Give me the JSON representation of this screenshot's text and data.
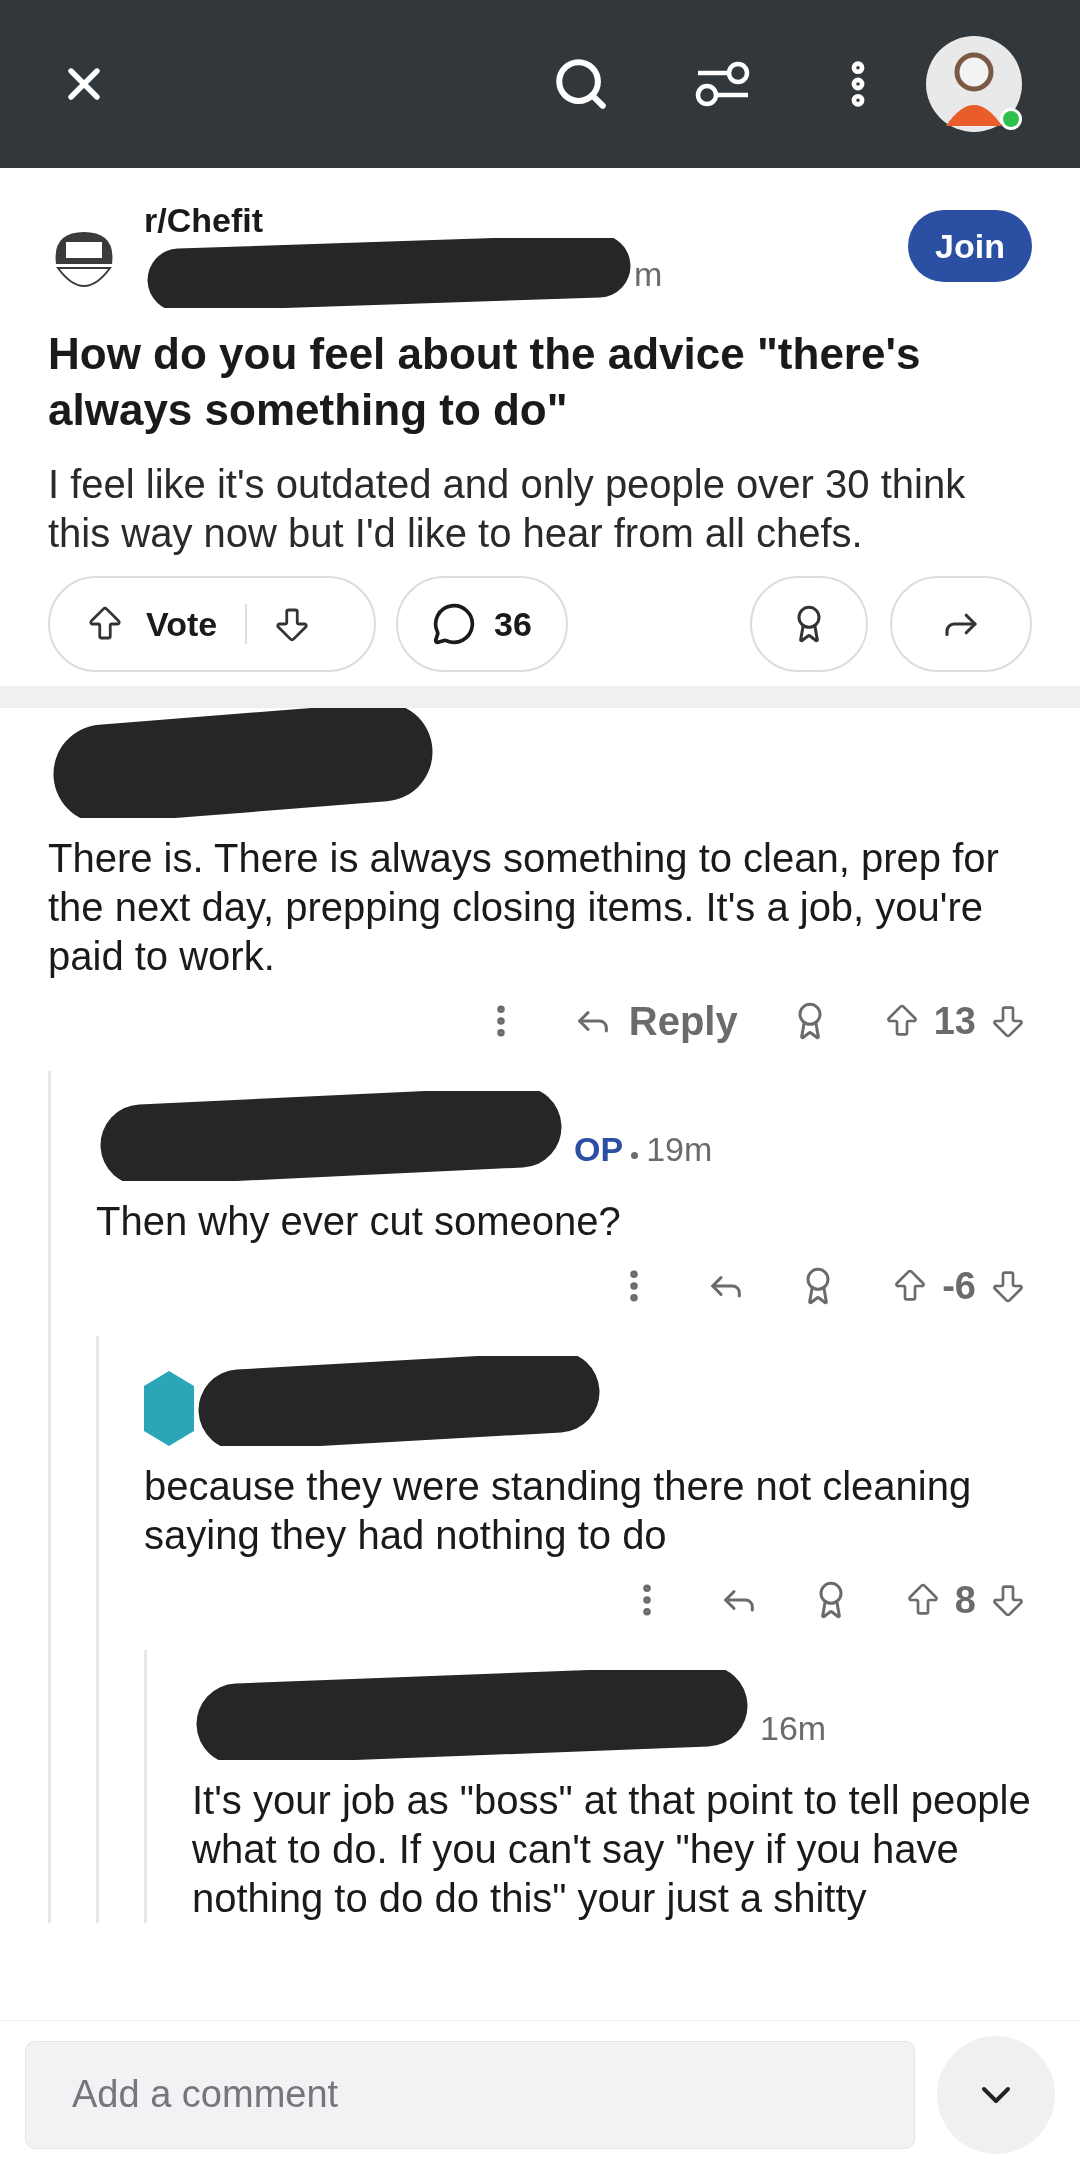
{
  "top_bar": {
    "avatar_online": true
  },
  "post": {
    "subreddit": "r/Chefit",
    "time_fragment": "m",
    "join_label": "Join",
    "title": "How do you feel about the advice \"there's always something to do\"",
    "body": "I feel like it's outdated and only people over 30 think this way now but I'd like to hear from all chefs.",
    "vote_label": "Vote",
    "comment_count": "36"
  },
  "comments": [
    {
      "text": "There is. There is always something to clean, prep for the next day, prepping closing items. It's a job, you're paid to work.",
      "reply_label": "Reply",
      "score": "13",
      "children": [
        {
          "op_badge": "OP",
          "time": "19m",
          "text": "Then why ever cut someone?",
          "score": "-6",
          "children": [
            {
              "text": "because they were standing there not cleaning saying they had nothing to do",
              "score": "8",
              "children": [
                {
                  "time": "16m",
                  "text": "It's your job as \"boss\" at that point to tell people what to do. If you can't say \"hey if you have nothing to do do this\" your just a shitty"
                }
              ]
            }
          ]
        }
      ]
    }
  ],
  "comment_bar": {
    "placeholder": "Add a comment"
  }
}
